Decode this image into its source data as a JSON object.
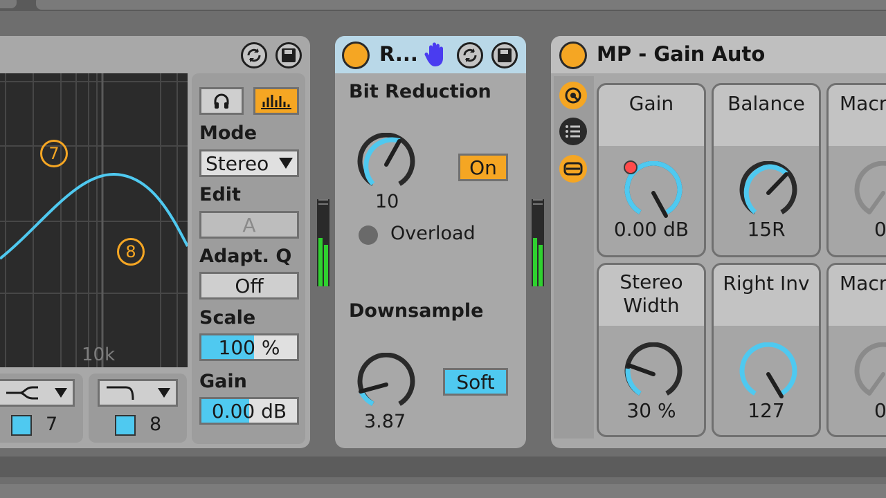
{
  "eq_device": {
    "grid_label": "10k",
    "band_markers": [
      "7",
      "8"
    ],
    "band7": {
      "number": "7"
    },
    "band8": {
      "number": "8"
    },
    "mode_label": "Mode",
    "mode_value": "Stereo",
    "edit_label": "Edit",
    "edit_value": "A",
    "adaptq_label": "Adapt. Q",
    "adaptq_value": "Off",
    "scale_label": "Scale",
    "scale_value": "100 %",
    "scale_fraction": 0.38,
    "gain_label": "Gain",
    "gain_value": "0.00 dB",
    "gain_fraction": 0.5
  },
  "redux_device": {
    "title": "R...",
    "bit_reduction_label": "Bit Reduction",
    "bit_value": "10",
    "on_label": "On",
    "overload_label": "Overload",
    "downsample_label": "Downsample",
    "downsample_value": "3.87",
    "soft_label": "Soft"
  },
  "rack_device": {
    "title": "MP - Gain Auto",
    "macros": [
      {
        "name": "Gain",
        "value": "0.00 dB"
      },
      {
        "name": "Balance",
        "value": "15R"
      },
      {
        "name": "Macr",
        "value": "0"
      },
      {
        "name": "Stereo Width",
        "value": "30 %"
      },
      {
        "name": "Right Inv",
        "value": "127"
      },
      {
        "name": "Macr",
        "value": "0"
      }
    ]
  },
  "colors": {
    "accent_orange": "#f5a623",
    "accent_blue": "#4fc9f0",
    "device_bg": "#a8a8a8",
    "hand_icon": "#4a3cf0"
  }
}
